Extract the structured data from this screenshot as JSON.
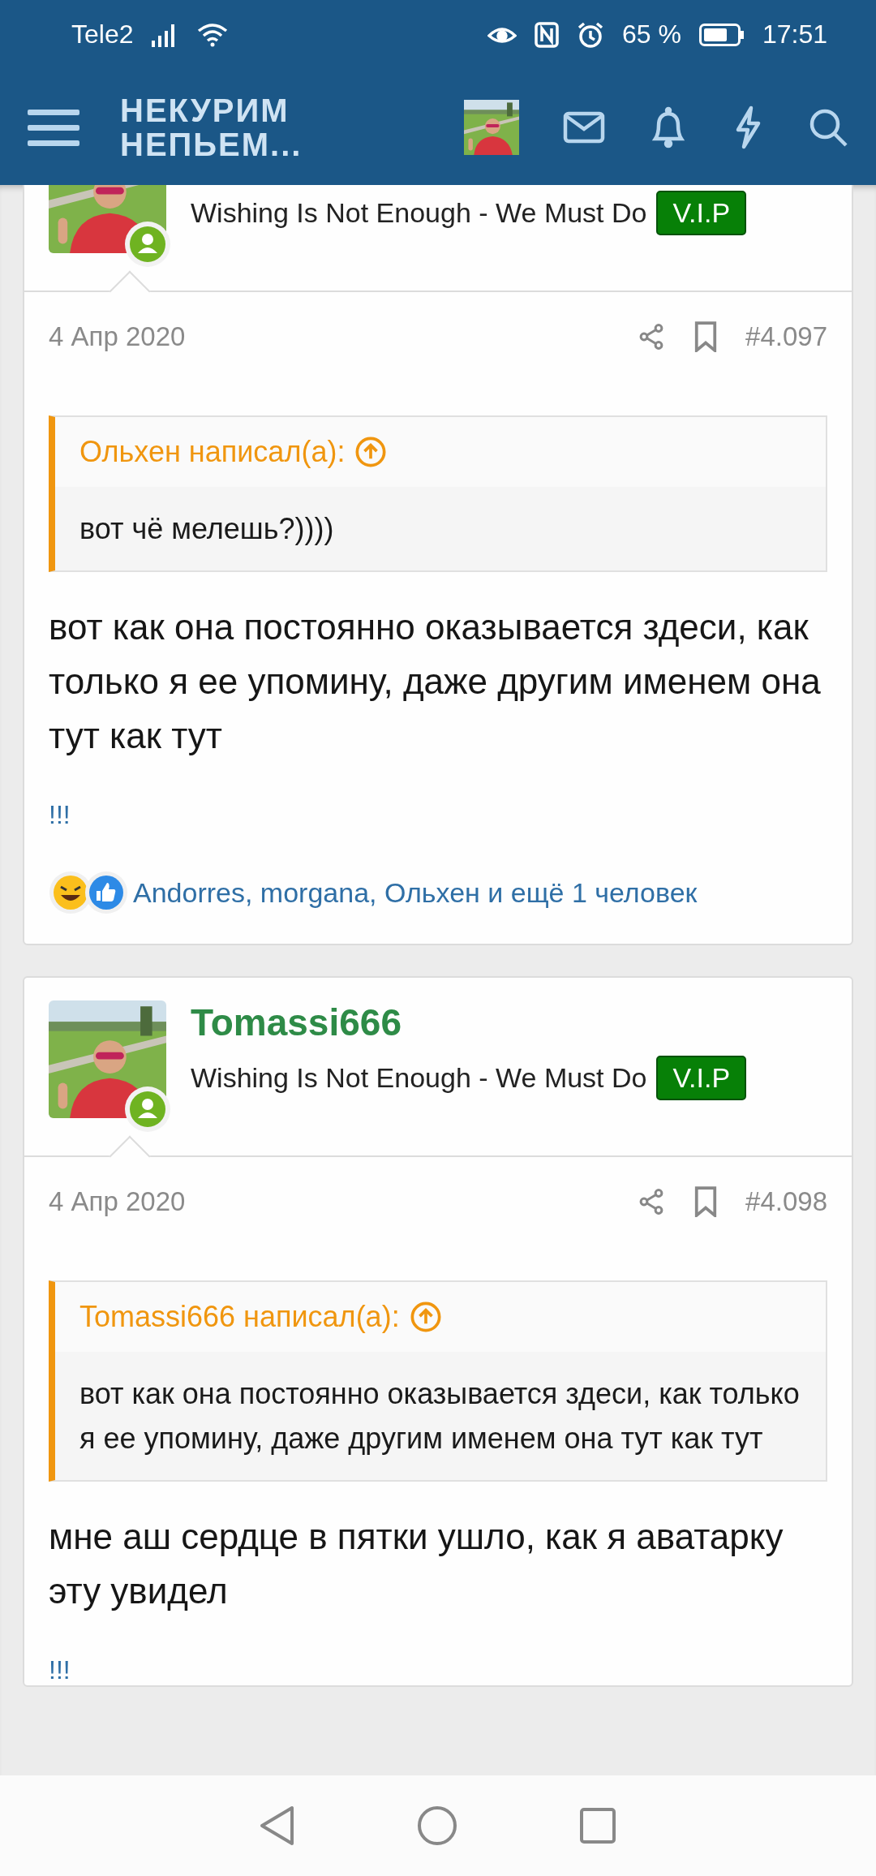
{
  "status_bar": {
    "carrier": "Tele2",
    "battery": "65 %",
    "time": "17:51"
  },
  "header": {
    "logo_lines": [
      "НЕКУРИМ",
      "НЕПЬЕМ..."
    ]
  },
  "posts": [
    {
      "user_title": "Wishing Is Not Enough - We Must Do",
      "badge": "V.I.P",
      "date": "4 Апр 2020",
      "number": "#4.097",
      "quote": {
        "header": "Ольхен написал(а):",
        "text": "вот чё мелешь?))))"
      },
      "body": "вот как она постоянно оказывается здеси, как только я ее упомину, даже другим именем она тут как тут",
      "signature": "!!!",
      "reactions": "Andorres, morgana, Ольхен и ещё 1 человек"
    },
    {
      "author": "Tomassi666",
      "user_title": "Wishing Is Not Enough - We Must Do",
      "badge": "V.I.P",
      "date": "4 Апр 2020",
      "number": "#4.098",
      "quote": {
        "header": "Tomassi666 написал(а):",
        "text": "вот как она постоянно оказывается здеси, как только я ее упомину, даже другим именем она тут как тут"
      },
      "body": "мне аш сердце в пятки ушло, как я аватарку эту увидел",
      "signature": "!!!"
    }
  ]
}
